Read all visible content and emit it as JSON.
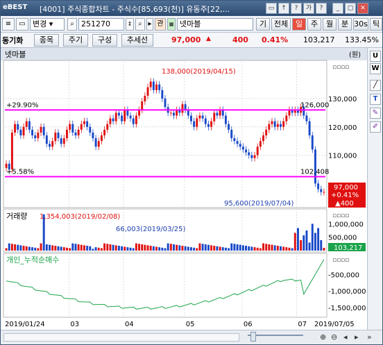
{
  "titlebar": {
    "logo": "eBEST",
    "title": "[4001] 주식종합차트 - 주식수[85,693(천)] 유동주[22,...",
    "buttons": [
      "▭",
      "↑",
      "?",
      "가",
      "?",
      "_",
      "▢",
      "✕"
    ]
  },
  "toolbar1": {
    "code_label": "동기화",
    "mode_label": "변경",
    "code_value": "251270",
    "tag_label": "관",
    "stock_name": "넷마블",
    "right_buttons": [
      "기",
      "전체",
      "일",
      "주",
      "월",
      "분",
      "30s",
      "틱"
    ],
    "active_button": "일"
  },
  "toolbar2": {
    "stock_label": "동기화",
    "buttons": [
      "종목",
      "주기",
      "구성",
      "추세선"
    ],
    "price": "97,000",
    "arrow": "▲",
    "change": "400",
    "pct": "0.41%",
    "volume": "103,217",
    "zoom": "133.45%"
  },
  "right_panel": {
    "buttons": [
      "U",
      "W",
      "╱",
      "T",
      "✎",
      "✐"
    ]
  },
  "chart_data": {
    "type": "candlestick",
    "title": "넷마블",
    "unit": "(원)",
    "price_panel": {
      "y_ticks": [
        130000,
        120000,
        110000
      ],
      "y_tick_labels": [
        "130,000",
        "120,000",
        "110,000"
      ],
      "ylim": [
        92000,
        143000
      ],
      "high_label": "138,000(2019/04/15)",
      "low_label": "95,600(2019/07/04)",
      "hlines": [
        {
          "value": 126000,
          "label_left": "+29.90%",
          "label_right": "126,000",
          "color": "#ff00ff"
        },
        {
          "value": 102408,
          "label_left": "+5.58%",
          "label_right": "102,408",
          "color": "#ff00ff"
        }
      ],
      "last_price_box": [
        "97,000",
        "+0.41%",
        "▲400"
      ],
      "closes": [
        107000,
        105000,
        118000,
        121000,
        119000,
        117000,
        120000,
        122000,
        119000,
        117000,
        116000,
        118000,
        120000,
        117000,
        114000,
        113000,
        115000,
        118000,
        116000,
        114000,
        116000,
        119000,
        121000,
        118000,
        117000,
        119000,
        121000,
        122000,
        120000,
        118000,
        116000,
        113000,
        115000,
        117000,
        119000,
        121000,
        123000,
        122000,
        125000,
        124000,
        122000,
        126000,
        124000,
        123000,
        121000,
        124000,
        126000,
        129000,
        131000,
        134000,
        136000,
        133000,
        135000,
        133000,
        130000,
        127000,
        125000,
        125000,
        124000,
        126000,
        125000,
        128000,
        126000,
        124000,
        122000,
        120000,
        123000,
        124000,
        123000,
        121000,
        120000,
        122000,
        125000,
        124000,
        126000,
        124000,
        121000,
        119000,
        116000,
        115000,
        114000,
        113000,
        112000,
        111000,
        110000,
        109000,
        110000,
        113000,
        115000,
        117000,
        119000,
        121000,
        122000,
        120000,
        121000,
        120000,
        122000,
        124000,
        126000,
        125000,
        126000,
        125000,
        127000,
        124000,
        122000,
        117000,
        112000,
        100000,
        98000,
        97000,
        97000
      ]
    },
    "volume_panel": {
      "label": "거래량",
      "y_tick_labels": [
        "1,000,000",
        "500,000"
      ],
      "ylim": [
        0,
        1450000
      ],
      "annotations": [
        "1,354,003(2019/02/08)",
        "66,003(2019/03/25)"
      ],
      "last_label": "103,217"
    },
    "individual_panel": {
      "label": "개인_누적순매수",
      "y_tick_labels": [
        "-500,000",
        "-1,000,000",
        "-1,500,000"
      ],
      "ylim": [
        -1750000,
        50000
      ]
    },
    "x_tick_labels": [
      "2019/01/24",
      "03",
      "04",
      "05",
      "06",
      "07",
      "2019/07/05"
    ]
  }
}
